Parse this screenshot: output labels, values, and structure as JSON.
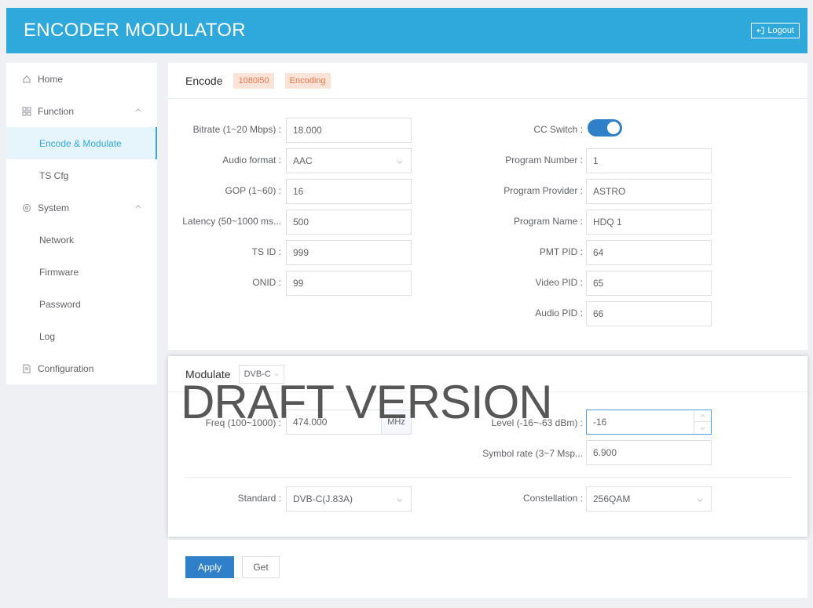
{
  "header": {
    "title": "ENCODER MODULATOR",
    "logout": "Logout"
  },
  "sidebar": {
    "items": [
      {
        "label": "Home"
      },
      {
        "label": "Function"
      },
      {
        "label": "Encode & Modulate"
      },
      {
        "label": "TS Cfg"
      },
      {
        "label": "System"
      },
      {
        "label": "Network"
      },
      {
        "label": "Firmware"
      },
      {
        "label": "Password"
      },
      {
        "label": "Log"
      },
      {
        "label": "Configuration"
      }
    ]
  },
  "encode": {
    "title": "Encode",
    "resolution_badge": "1080i50",
    "status_badge": "Encoding",
    "bitrate": {
      "label": "Bitrate (1~20 Mbps) :",
      "value": "18.000"
    },
    "audio_format": {
      "label": "Audio format :",
      "value": "AAC"
    },
    "gop": {
      "label": "GOP (1~60) :",
      "value": "16"
    },
    "latency": {
      "label": "Latency (50~1000 ms...",
      "value": "500"
    },
    "ts_id": {
      "label": "TS ID :",
      "value": "999"
    },
    "onid": {
      "label": "ONID :",
      "value": "99"
    },
    "cc_switch": {
      "label": "CC Switch :",
      "on": true
    },
    "program_number": {
      "label": "Program Number :",
      "value": "1"
    },
    "program_provider": {
      "label": "Program Provider :",
      "value": "ASTRO"
    },
    "program_name": {
      "label": "Program Name :",
      "value": "HDQ 1"
    },
    "pmt_pid": {
      "label": "PMT PID :",
      "value": "64"
    },
    "video_pid": {
      "label": "Video PID :",
      "value": "65"
    },
    "audio_pid": {
      "label": "Audio PID :",
      "value": "66"
    }
  },
  "modulate": {
    "title": "Modulate",
    "mode": "DVB-C",
    "freq": {
      "label": "Freq (100~1000) :",
      "value": "474.000",
      "unit": "MHz"
    },
    "level": {
      "label": "Level (-16~-63 dBm) :",
      "value": "-16"
    },
    "symbol_rate": {
      "label": "Symbol rate (3~7 Msp...",
      "value": "6.900"
    },
    "standard": {
      "label": "Standard :",
      "value": "DVB-C(J.83A)"
    },
    "constellation": {
      "label": "Constellation :",
      "value": "256QAM"
    }
  },
  "actions": {
    "apply": "Apply",
    "get": "Get"
  },
  "watermark": "DRAFT VERSION",
  "colors": {
    "header": "#2fa8dc",
    "primary": "#2f80c8",
    "badge_bg": "#fbe3d8",
    "badge_text": "#e8784a"
  }
}
